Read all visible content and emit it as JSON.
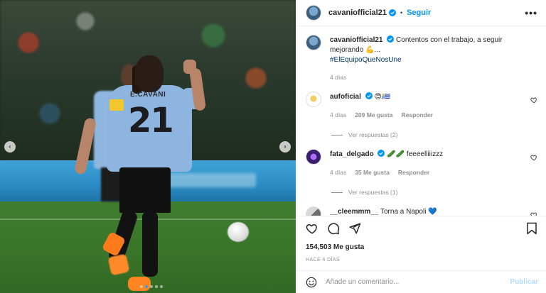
{
  "post": {
    "username": "cavaniofficial21",
    "follow_label": "Seguir",
    "separator": "•",
    "more_label": "•••",
    "caption": {
      "username": "cavaniofficial21",
      "text": "Contentos con el trabajo, a seguir mejorando 💪...",
      "hashtag": "#ElEquipoQueNosUne",
      "time": "4 días"
    },
    "jersey": {
      "name": "E.CAVANI",
      "number": "21"
    }
  },
  "comments": [
    {
      "username": "aufoficial",
      "text": "😍🇺🇾",
      "time": "4 días",
      "likes": "209 Me gusta",
      "reply": "Responder",
      "view_replies": "Ver respuestas (2)"
    },
    {
      "username": "fata_delgado",
      "text": "🥒🥒 feeeelliiizzz",
      "time": "4 días",
      "likes": "35 Me gusta",
      "reply": "Responder",
      "view_replies": "Ver respuestas (1)"
    },
    {
      "username": "__cleemmm__",
      "text": "Torna a Napoli 💙"
    }
  ],
  "actions": {
    "likes": "154,503 Me gusta",
    "posted_ago": "HACE 4 DÍAS"
  },
  "add_comment": {
    "placeholder": "Añade un comentario...",
    "publish_label": "Publicar"
  },
  "carousel": {
    "prev": "‹",
    "next": "›",
    "slides": 5,
    "active_slide": 1
  },
  "colors": {
    "link": "#0095f6",
    "hashtag": "#00376b",
    "publish_disabled": "#b3dbff",
    "jersey": "#8db5df"
  }
}
